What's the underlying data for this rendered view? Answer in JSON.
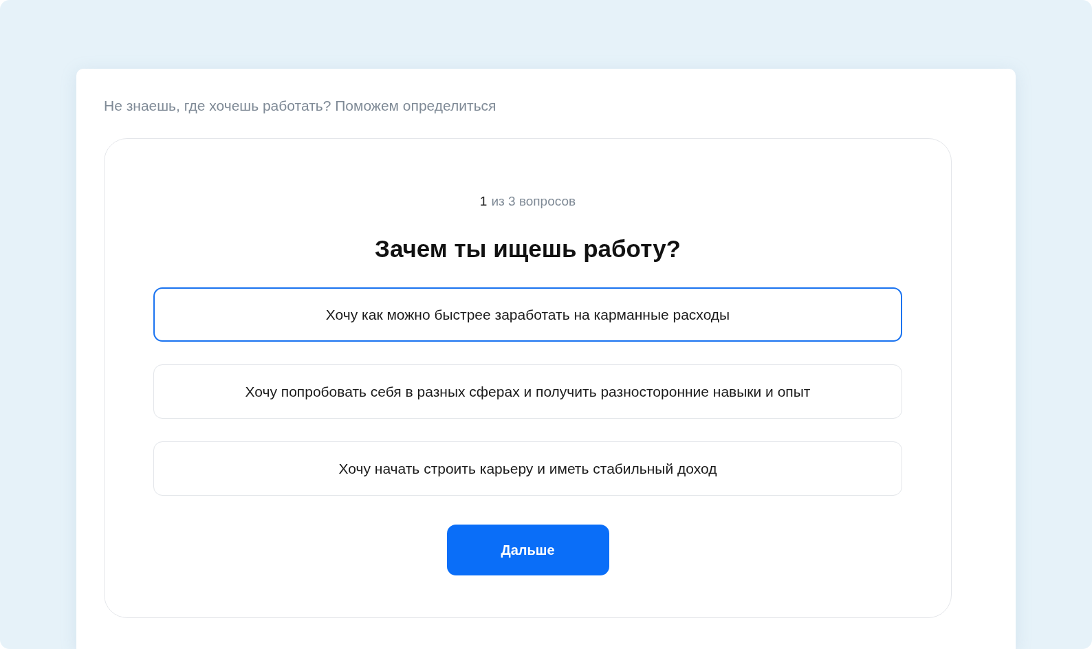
{
  "intro": "Не знаешь, где хочешь работать? Поможем определиться",
  "progress": {
    "current": "1",
    "label": "из 3 вопросов"
  },
  "question": "Зачем ты ищешь работу?",
  "options": [
    {
      "label": "Хочу как можно быстрее заработать на карманные расходы",
      "selected": true
    },
    {
      "label": "Хочу попробовать себя в разных сферах и получить разносторонние навыки и опыт",
      "selected": false
    },
    {
      "label": "Хочу начать строить карьеру и иметь стабильный доход",
      "selected": false
    }
  ],
  "next_button": "Дальше"
}
